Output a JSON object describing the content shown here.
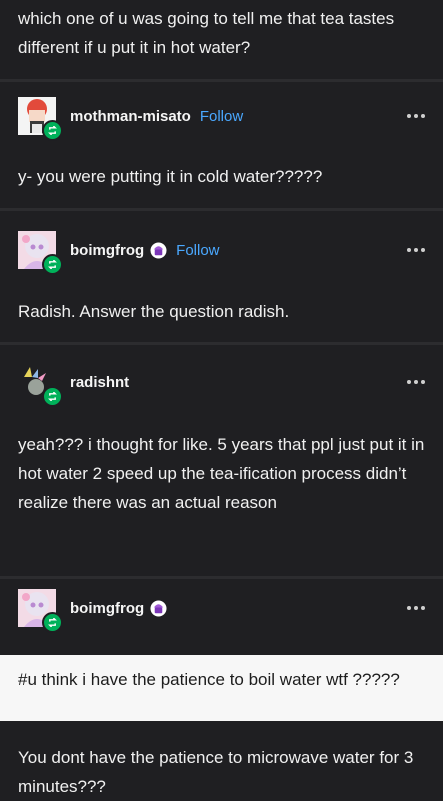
{
  "posts": [
    {
      "text": "which one of u was going to tell me that tea tastes different if u put it in hot water?"
    },
    {
      "username": "mothman-misato",
      "follow": "Follow",
      "text": "y- you were putting it in cold water?????"
    },
    {
      "username": "boimgfrog",
      "follow": "Follow",
      "text": "Radish. Answer the question radish."
    },
    {
      "username": "radishnt",
      "text": "yeah??? i thought for like. 5 years that ppl just put it in hot water 2 speed up the tea-ification process didn’t realize there was an actual reason"
    },
    {
      "username": "boimgfrog",
      "tag_text": "#u think i have the patience to boil water wtf ?????",
      "text": "You dont have the patience to microwave water for 3 minutes???"
    }
  ],
  "icons": {
    "reblog": "reblog-icon",
    "more": "more-options-icon",
    "badge": "purple-cupcake-badge-icon"
  },
  "colors": {
    "background": "#1f1f22",
    "follow": "#4aa8ff",
    "reblog": "#00b15a",
    "tag_box": "#f7f7f7"
  }
}
